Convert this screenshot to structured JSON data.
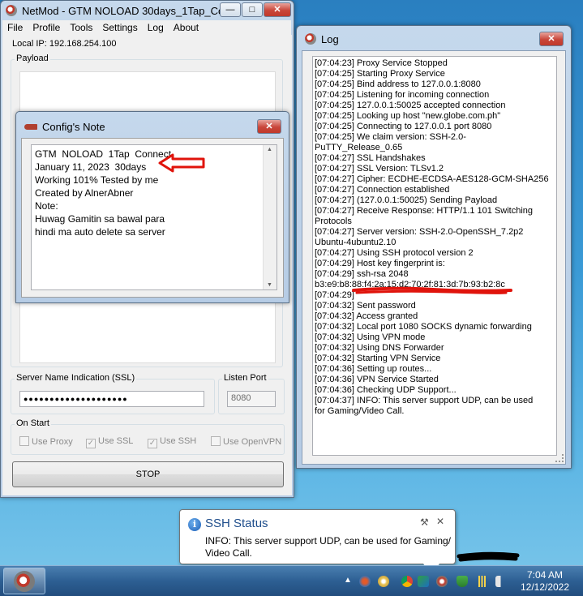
{
  "netmod": {
    "title": "NetMod - GTM NOLOAD 30days_1Tap_Co...",
    "min_glyph": "—",
    "max_glyph": "□",
    "close_glyph": "✕",
    "menu": [
      "File",
      "Profile",
      "Tools",
      "Settings",
      "Log",
      "About"
    ],
    "local_ip": "Local IP: 192.168.254.100",
    "payload_label": "Payload",
    "sni_label": "Server Name Indication (SSL)",
    "sni_value": "●●●●●●●●●●●●●●●●●●●●",
    "listen_port_label": "Listen Port",
    "listen_port_value": "8080",
    "on_start_label": "On Start",
    "options": [
      {
        "label": "Use Proxy",
        "checked": false
      },
      {
        "label": "Use SSL",
        "checked": true
      },
      {
        "label": "Use SSH",
        "checked": true
      },
      {
        "label": "Use OpenVPN",
        "checked": false
      }
    ],
    "stop_label": "STOP"
  },
  "config_note": {
    "title": "Config's Note",
    "close_glyph": "✕",
    "lines": [
      "GTM  NOLOAD  1Tap  Connect",
      "January 11, 2023  30days",
      "Working 101% Tested by me",
      "",
      "Created by AlnerAbner",
      "",
      "Note:",
      "Huwag Gamitin sa bawal para",
      "hindi ma auto delete sa server"
    ]
  },
  "log": {
    "title": "Log",
    "close_glyph": "✕",
    "lines": [
      "[07:04:23] Proxy Service Stopped",
      "[07:04:25] Starting Proxy Service",
      "[07:04:25] Bind address to 127.0.0.1:8080",
      "[07:04:25] Listening for incoming connection",
      "[07:04:25] 127.0.0.1:50025 accepted connection",
      "[07:04:25] Looking up host \"new.globe.com.ph\"",
      "[07:04:25] Connecting to 127.0.0.1 port 8080",
      "[07:04:25] We claim version: SSH-2.0-",
      "PuTTY_Release_0.65",
      "[07:04:27] SSL Handshakes",
      "[07:04:27] SSL Version: TLSv1.2",
      "[07:04:27] Cipher: ECDHE-ECDSA-AES128-GCM-SHA256",
      "[07:04:27] Connection established",
      "[07:04:27] (127.0.0.1:50025) Sending Payload",
      "[07:04:27] Receive Response: HTTP/1.1 101 Switching",
      "Protocols",
      "[07:04:27] Server version: SSH-2.0-OpenSSH_7.2p2",
      "Ubuntu-4ubuntu2.10",
      "[07:04:27] Using SSH protocol version 2",
      "[07:04:29] Host key fingerprint is:",
      "[07:04:29] ssh-rsa 2048",
      "b3:e9:b8:88:f4:2a:15:d2:70:2f:81:3d:7b:93:b2:8c",
      "[07:04:29]",
      "[07:04:32] Sent password",
      "[07:04:32] Access granted",
      "[07:04:32] Local port 1080 SOCKS dynamic forwarding",
      "[07:04:32] Using VPN mode",
      "[07:04:32] Using DNS Forwarder",
      "[07:04:32] Starting VPN Service",
      "[07:04:36] Setting up routes...",
      "[07:04:36] VPN Service Started",
      "[07:04:36] Checking UDP Support...",
      "[07:04:37] INFO: This server support UDP, can be used",
      "for Gaming/Video Call."
    ]
  },
  "balloon": {
    "info_glyph": "i",
    "title": "SSH Status",
    "line1": "INFO: This server support UDP, can be used for Gaming/",
    "line2": "Video Call.",
    "tool_glyph": "⚒",
    "close_glyph": "✕"
  },
  "taskbar": {
    "time": "7:04 AM",
    "date": "12/12/2022",
    "tray_icons": [
      "capture-icon",
      "media-icon",
      "chrome-icon",
      "network-share-icon",
      "netmod-tray-icon",
      "security-icon",
      "signal-icon",
      "volume-icon"
    ]
  },
  "colors": {
    "annotation_red": "#e0140c",
    "title_blue": "#1f4e8c"
  }
}
